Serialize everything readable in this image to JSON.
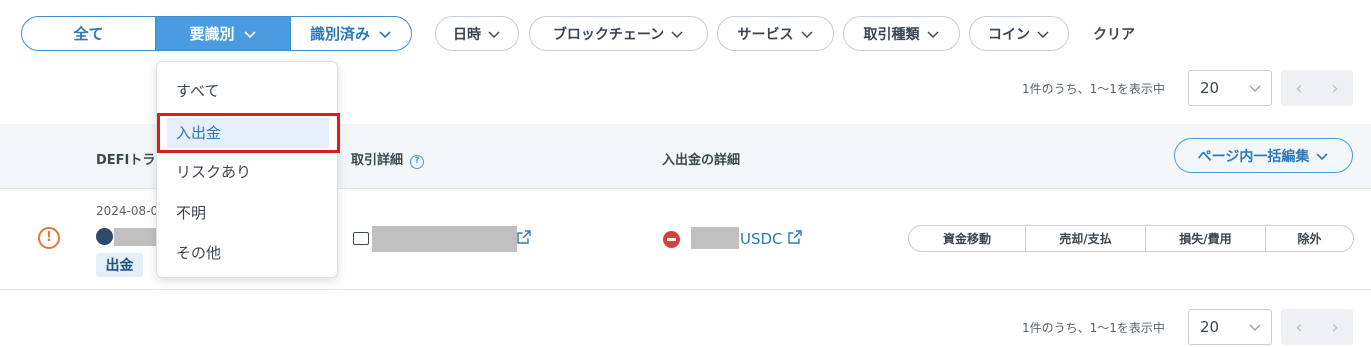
{
  "filters": {
    "segment": [
      "全て",
      "要識別",
      "識別済み"
    ],
    "pills": [
      "日時",
      "ブロックチェーン",
      "サービス",
      "取引種類",
      "コイン"
    ],
    "clear": "クリア"
  },
  "pagination": {
    "summary": "1件のうち、1〜1を表示中",
    "page_size": "20",
    "prev": "‹",
    "next": "›"
  },
  "table": {
    "headers": {
      "col1": "DEFIトラ",
      "col2": "取引詳細",
      "col3": "入出金の詳細"
    },
    "bulk_edit": "ページ内一括編集",
    "rows": [
      {
        "date": "2024-08-0",
        "type_badge": "出金",
        "coin": "USDC",
        "categories": [
          "資金移動",
          "売却/支払",
          "損失/費用",
          "除外"
        ]
      }
    ]
  },
  "dropdown": {
    "items": [
      "すべて",
      "入出金",
      "リスクあり",
      "不明",
      "その他"
    ],
    "selected": "入出金"
  },
  "colors": {
    "accent": "#4a9be0",
    "warning": "#e07a3a",
    "danger": "#d2443a",
    "highlight_box": "#e01b1b"
  }
}
